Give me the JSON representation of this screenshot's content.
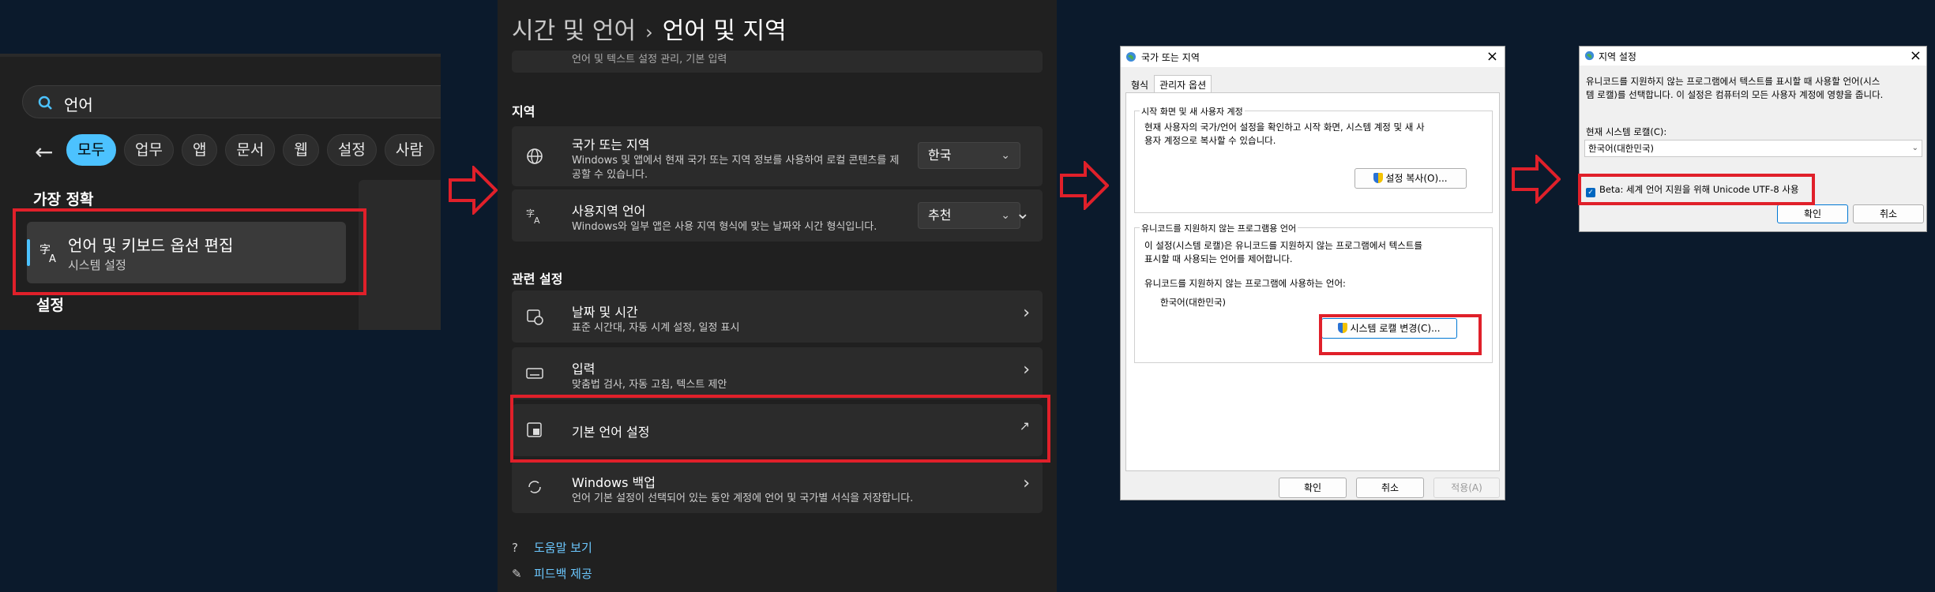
{
  "search_panel": {
    "query": "언어",
    "filters": [
      "모두",
      "업무",
      "앱",
      "문서",
      "웹",
      "설정",
      "사람"
    ],
    "best_match_heading": "가장 정확",
    "result_title": "언어 및 키보드 옵션 편집",
    "result_subtitle": "시스템 설정",
    "settings_heading": "설정"
  },
  "settings_panel": {
    "breadcrumb_parent": "시간 및 언어",
    "breadcrumb_sep": "›",
    "page_title": "언어 및 지역",
    "truncated_top": "언어 및 텍스트 설정 관리, 기본 입력",
    "region_heading": "지역",
    "country": {
      "title": "국가 또는 지역",
      "desc": "Windows 및 앱에서 현재 국가 또는 지역 정보를 사용하여 로컬 콘텐츠를 제",
      "desc2": "공할 수 있습니다.",
      "value": "한국"
    },
    "regional_format": {
      "title": "사용지역 언어",
      "desc": "Windows와 일부 앱은 사용 지역 형식에 맞는 날짜와 시간 형식입니다.",
      "value": "추천"
    },
    "related_heading": "관련 설정",
    "datetime": {
      "title": "날짜 및 시간",
      "desc": "표준 시간대, 자동 시계 설정, 일정 표시"
    },
    "typing": {
      "title": "입력",
      "desc": "맞춤법 검사, 자동 고침, 텍스트 제안"
    },
    "admin_lang": {
      "title": "기본 언어 설정"
    },
    "backup": {
      "title": "Windows 백업",
      "desc": "언어 기본 설정이 선택되어 있는 동안 계정에 언어 및 국가별 서식을 저장합니다."
    },
    "help_link": "도움말 보기",
    "feedback_link": "피드백 제공"
  },
  "region_dialog": {
    "title": "국가 또는 지역",
    "tabs": [
      "형식",
      "관리자 옵션"
    ],
    "welcome_group": "시작 화면 및 새 사용자 계정",
    "welcome_text1": "현재 사용자의 국가/언어 설정을 확인하고 시작 화면, 시스템 계정 및 새 사",
    "welcome_text2": "용자 계정으로 복사할 수 있습니다.",
    "copy_button": "설정 복사(O)...",
    "unicode_group": "유니코드를 지원하지 않는 프로그램용 언어",
    "unicode_text1": "이 설정(시스템 로캘)은 유니코드를 지원하지 않는 프로그램에서 텍스트를",
    "unicode_text2": "표시할 때 사용되는 언어를 제어합니다.",
    "current_label": "유니코드를 지원하지 않는 프로그램에 사용하는 언어:",
    "current_value": "한국어(대한민국)",
    "change_button": "시스템 로캘 변경(C)...",
    "ok": "확인",
    "cancel": "취소",
    "apply": "적용(A)"
  },
  "locale_dialog": {
    "title": "지역 설정",
    "desc1": "유니코드를 지원하지 않는 프로그램에서 텍스트를 표시할 때 사용할 언어(시스",
    "desc2": "템 로캘)를 선택합니다. 이 설정은 컴퓨터의 모든 사용자 계정에 영향을 줍니다.",
    "current_label": "현재 시스템 로캘(C):",
    "current_value": "한국어(대한민국)",
    "beta_checkbox": "Beta: 세계 언어 지원을 위해 Unicode UTF-8 사용",
    "beta_checked": true,
    "ok": "확인",
    "cancel": "취소"
  },
  "colors": {
    "highlight_red": "#e0202a",
    "accent": "#4cc2ff",
    "link": "#6cc8ff"
  }
}
